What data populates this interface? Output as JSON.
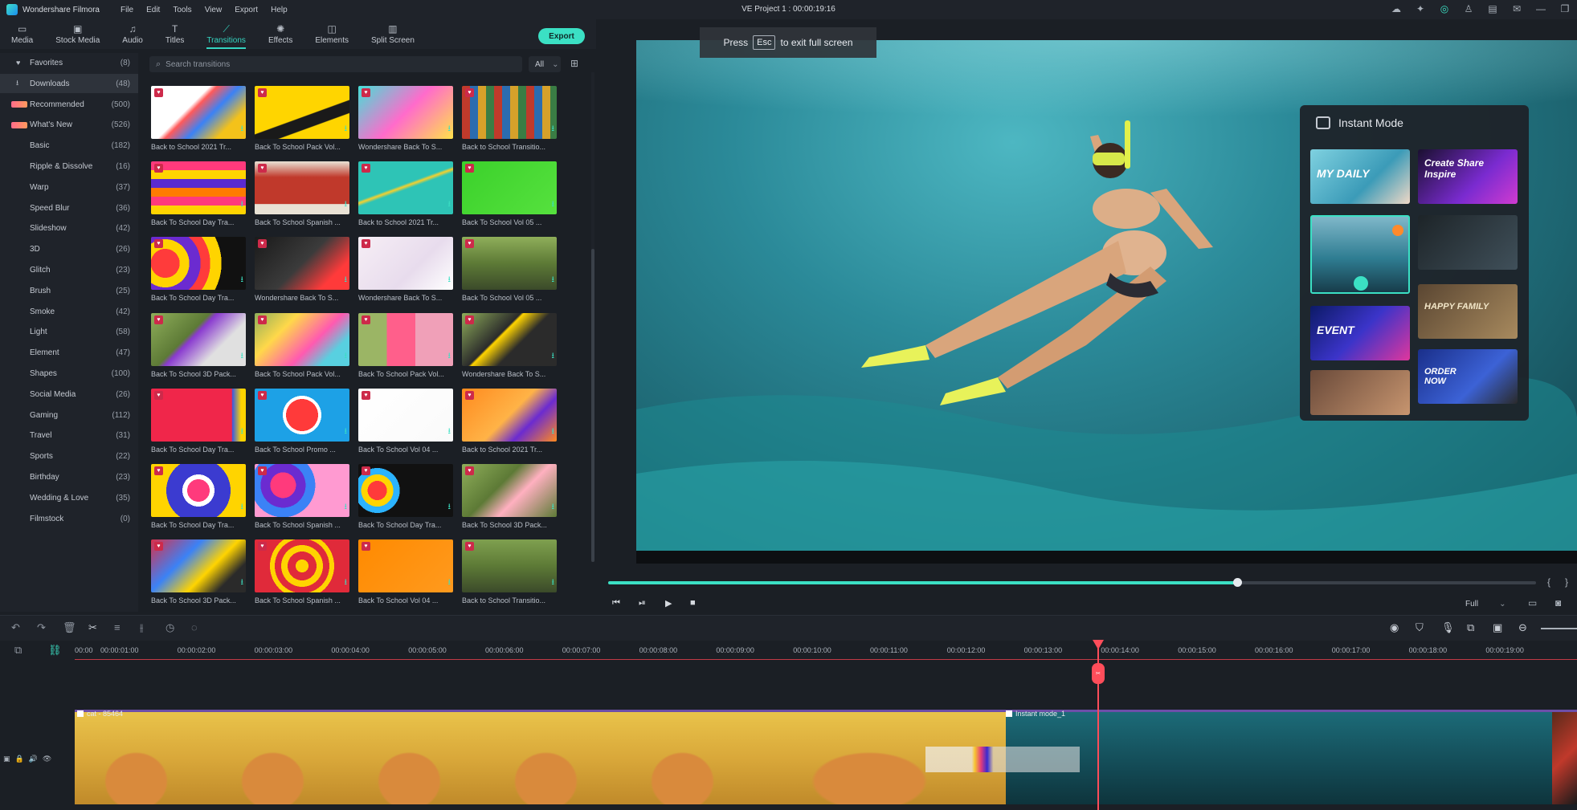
{
  "app": {
    "name": "Wondershare Filmora",
    "project_title": "VE Project 1 : 00:00:19:16",
    "menu": [
      "File",
      "Edit",
      "Tools",
      "View",
      "Export",
      "Help"
    ]
  },
  "toolbar": {
    "tabs": [
      {
        "label": "Media",
        "icon": "folder-icon"
      },
      {
        "label": "Stock Media",
        "icon": "stock-icon"
      },
      {
        "label": "Audio",
        "icon": "music-icon"
      },
      {
        "label": "Titles",
        "icon": "text-icon"
      },
      {
        "label": "Transitions",
        "icon": "transition-icon"
      },
      {
        "label": "Effects",
        "icon": "effects-icon"
      },
      {
        "label": "Elements",
        "icon": "elements-icon"
      },
      {
        "label": "Split Screen",
        "icon": "split-screen-icon"
      }
    ],
    "active_tab": "Transitions",
    "export_label": "Export"
  },
  "categories": [
    {
      "label": "Favorites",
      "count": "(8)"
    },
    {
      "label": "Downloads",
      "count": "(48)"
    },
    {
      "label": "Recommended",
      "count": "(500)"
    },
    {
      "label": "What's New",
      "count": "(526)"
    },
    {
      "label": "Basic",
      "count": "(182)"
    },
    {
      "label": "Ripple & Dissolve",
      "count": "(16)"
    },
    {
      "label": "Warp",
      "count": "(37)"
    },
    {
      "label": "Speed Blur",
      "count": "(36)"
    },
    {
      "label": "Slideshow",
      "count": "(42)"
    },
    {
      "label": "3D",
      "count": "(26)"
    },
    {
      "label": "Glitch",
      "count": "(23)"
    },
    {
      "label": "Brush",
      "count": "(25)"
    },
    {
      "label": "Smoke",
      "count": "(42)"
    },
    {
      "label": "Light",
      "count": "(58)"
    },
    {
      "label": "Element",
      "count": "(47)"
    },
    {
      "label": "Shapes",
      "count": "(100)"
    },
    {
      "label": "Social Media",
      "count": "(26)"
    },
    {
      "label": "Gaming",
      "count": "(112)"
    },
    {
      "label": "Travel",
      "count": "(31)"
    },
    {
      "label": "Sports",
      "count": "(22)"
    },
    {
      "label": "Birthday",
      "count": "(23)"
    },
    {
      "label": "Wedding & Love",
      "count": "(35)"
    },
    {
      "label": "Filmstock",
      "count": "(0)"
    }
  ],
  "search": {
    "placeholder": "Search transitions",
    "filter": "All"
  },
  "transitions": [
    {
      "caption": "Back to School 2021 Tr..."
    },
    {
      "caption": "Back To School Pack Vol..."
    },
    {
      "caption": "Wondershare Back To S..."
    },
    {
      "caption": "Back to School Transitio..."
    },
    {
      "caption": "Back To School Day Tra..."
    },
    {
      "caption": "Back To School Spanish ..."
    },
    {
      "caption": "Back to School 2021 Tr..."
    },
    {
      "caption": "Back To School Vol 05 ..."
    },
    {
      "caption": "Back To School Day Tra..."
    },
    {
      "caption": "Wondershare Back To S..."
    },
    {
      "caption": "Wondershare Back To S..."
    },
    {
      "caption": "Back To School Vol 05 ..."
    },
    {
      "caption": "Back To School 3D Pack..."
    },
    {
      "caption": "Back To School Pack Vol..."
    },
    {
      "caption": "Back To School Pack Vol..."
    },
    {
      "caption": "Wondershare Back To S..."
    },
    {
      "caption": "Back To School Day Tra..."
    },
    {
      "caption": "Back To School Promo ..."
    },
    {
      "caption": "Back To School Vol 04 ..."
    },
    {
      "caption": "Back to School 2021 Tr..."
    },
    {
      "caption": "Back To School Day Tra..."
    },
    {
      "caption": "Back To School Spanish ..."
    },
    {
      "caption": "Back To School Day Tra..."
    },
    {
      "caption": "Back To School 3D Pack..."
    },
    {
      "caption": "Back To School 3D Pack..."
    },
    {
      "caption": "Back To School Spanish ..."
    },
    {
      "caption": "Back To School Vol 04 ..."
    },
    {
      "caption": "Back to School Transitio..."
    }
  ],
  "preview": {
    "esc_press": "Press",
    "esc_key": "Esc",
    "esc_suffix": "to exit full screen",
    "instant_mode_title": "Instant Mode",
    "templates": [
      {
        "text": "MY DAILY"
      },
      {
        "text": "Create Share Inspire"
      },
      {
        "text": ""
      },
      {
        "text": ""
      },
      {
        "text": "EVENT"
      },
      {
        "text": "HAPPY FAMILY"
      },
      {
        "text": ""
      },
      {
        "text": "ORDER NOW"
      }
    ],
    "quality": "Full",
    "progress": 0.678
  },
  "timeline": {
    "ticks": [
      "00:00",
      "00:00:01:00",
      "00:00:02:00",
      "00:00:03:00",
      "00:00:04:00",
      "00:00:05:00",
      "00:00:06:00",
      "00:00:07:00",
      "00:00:08:00",
      "00:00:09:00",
      "00:00:10:00",
      "00:00:11:00",
      "00:00:12:00",
      "00:00:13:00",
      "00:00:14:00",
      "00:00:15:00",
      "00:00:16:00",
      "00:00:17:00",
      "00:00:18:00",
      "00:00:19:00"
    ],
    "clip1_label": "cat - 85464",
    "clip2_label": "Instant mode_1"
  }
}
